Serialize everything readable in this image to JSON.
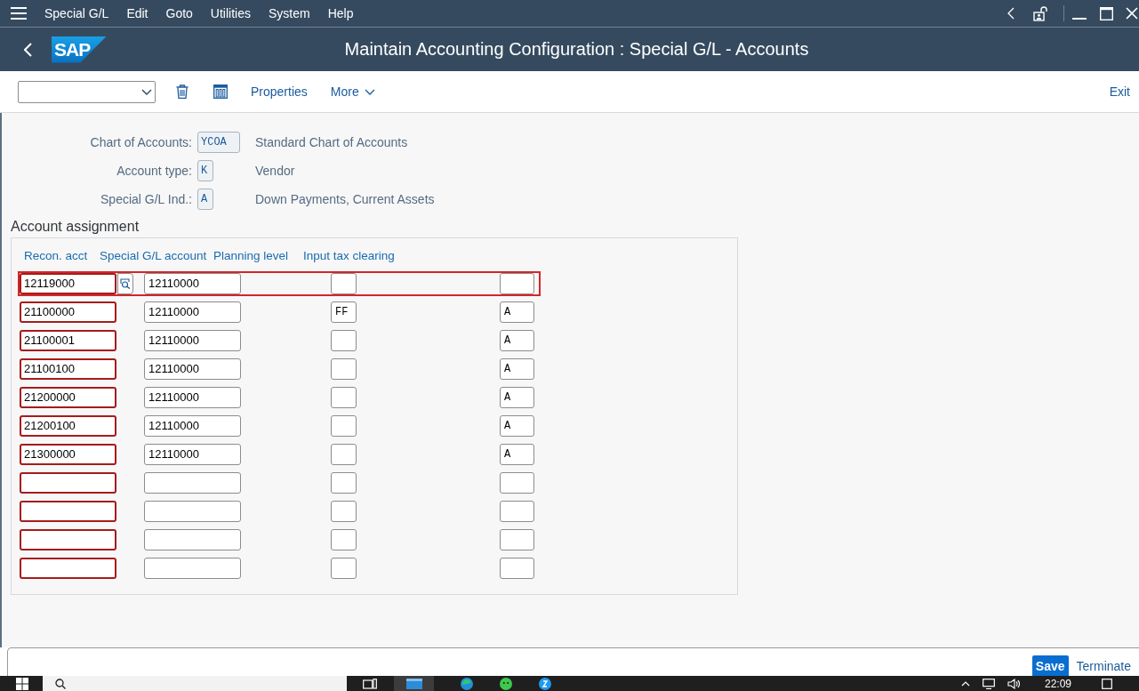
{
  "menu_bar": {
    "items": [
      "Special G/L",
      "Edit",
      "Goto",
      "Utilities",
      "System",
      "Help"
    ]
  },
  "title_bar": {
    "logo": "SAP",
    "title": "Maintain Accounting Configuration : Special G/L - Accounts"
  },
  "toolbar": {
    "items": [
      {
        "kind": "link",
        "label": "Properties"
      },
      {
        "kind": "menu",
        "label": "More"
      }
    ],
    "exit": "Exit"
  },
  "header_fields": [
    {
      "label": "Chart of Accounts:",
      "value": "YCOA",
      "description": "Standard Chart of Accounts"
    },
    {
      "label": "Account type:",
      "value": "K",
      "description": "Vendor"
    },
    {
      "label": "Special G/L Ind.:",
      "value": "A",
      "description": "Down Payments, Current Assets"
    }
  ],
  "account_assignment": {
    "title": "Account assignment",
    "columns": [
      {
        "label": "Recon. acct",
        "required": true
      },
      {
        "label": "Special G/L account",
        "required": false
      },
      {
        "label": "Planning level",
        "required": false
      },
      {
        "label": "Input tax clearing",
        "required": false
      }
    ],
    "rows": [
      {
        "recon_acct": "12119000",
        "special_gl_account": "12110000",
        "focused": true,
        "highlighted": true
      },
      {
        "recon_acct": "21100000",
        "special_gl_account": "12110000",
        "planning_level": "FF",
        "input_tax_clearing": "A",
        "focused": false,
        "highlighted": false
      },
      {
        "recon_acct": "21100001",
        "special_gl_account": "12110000",
        "input_tax_clearing": "A",
        "focused": false,
        "highlighted": false
      },
      {
        "recon_acct": "21100100",
        "special_gl_account": "12110000",
        "input_tax_clearing": "A",
        "focused": false,
        "highlighted": false
      },
      {
        "recon_acct": "21200000",
        "special_gl_account": "12110000",
        "input_tax_clearing": "A",
        "focused": false,
        "highlighted": false
      },
      {
        "recon_acct": "21200100",
        "special_gl_account": "12110000",
        "input_tax_clearing": "A",
        "focused": false,
        "highlighted": false
      },
      {
        "recon_acct": "21300000",
        "special_gl_account": "12110000",
        "input_tax_clearing": "A",
        "focused": false,
        "highlighted": false
      },
      {
        "focused": false,
        "highlighted": false
      },
      {
        "focused": false,
        "highlighted": false
      },
      {
        "focused": false,
        "highlighted": false
      },
      {
        "focused": false,
        "highlighted": false
      }
    ]
  },
  "footer": {
    "buttons": [
      {
        "kind": "primary",
        "label": "Save"
      },
      {
        "kind": "link",
        "label": "Terminate"
      }
    ]
  },
  "taskbar": {
    "time": "22:09"
  }
}
